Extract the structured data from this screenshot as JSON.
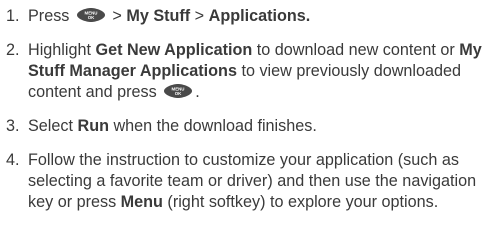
{
  "steps": [
    {
      "number": "1.",
      "parts": {
        "a": "Press ",
        "icon_label_top": "MENU",
        "icon_label_bottom": "OK",
        "b": " > ",
        "c": "My Stuff",
        "d": " > ",
        "e": "Applications."
      }
    },
    {
      "number": "2.",
      "parts": {
        "a": "Highlight ",
        "b": "Get New Application",
        "c": " to download new content or ",
        "d": "My Stuff Manager Applications",
        "e": " to view previously downloaded content and press ",
        "icon_label_top": "MENU",
        "icon_label_bottom": "OK",
        "f": "."
      }
    },
    {
      "number": "3.",
      "parts": {
        "a": "Select ",
        "b": "Run",
        "c": " when the download finishes."
      }
    },
    {
      "number": "4.",
      "parts": {
        "a": "Follow the instruction to customize your application (such as selecting a favorite team or driver) and then use the navigation key or press ",
        "b": "Menu",
        "c": " (right softkey) to explore your options."
      }
    }
  ],
  "colors": {
    "text": "#3a3a3a",
    "icon_fill": "#4a4a4a",
    "icon_text": "#ffffff"
  },
  "icons": {
    "menu_ok": "menu-ok-key-icon"
  }
}
